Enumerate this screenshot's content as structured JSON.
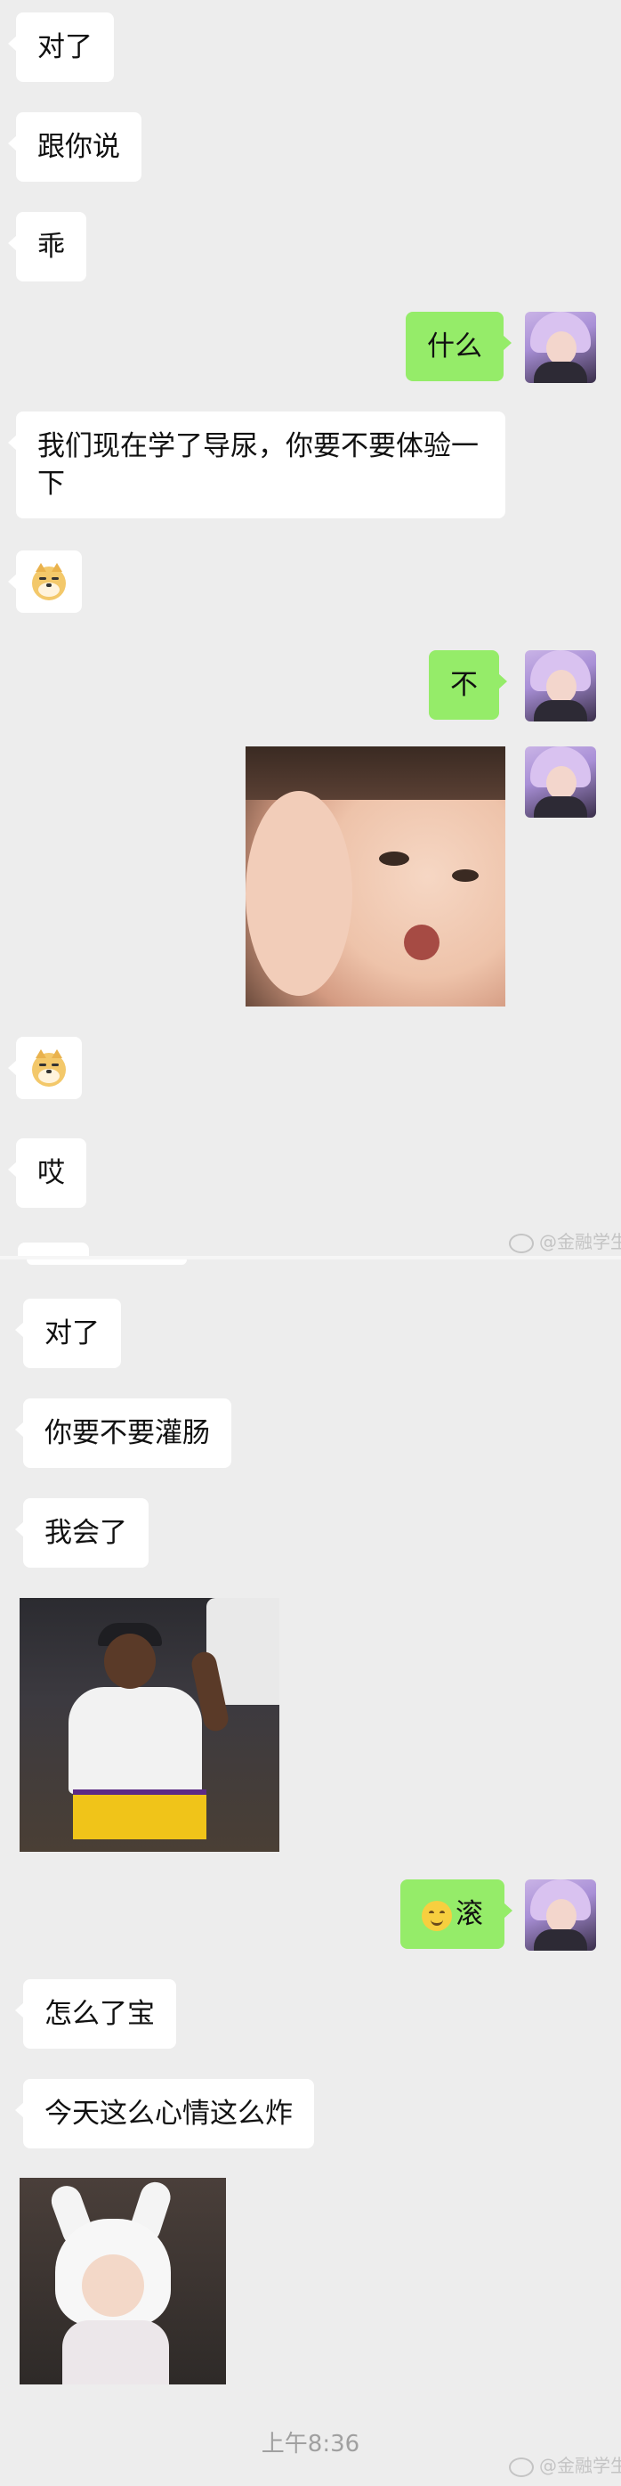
{
  "messages_top": [
    {
      "text": "对了"
    },
    {
      "text": "跟你说"
    },
    {
      "text": "乖"
    },
    {
      "text": "什么"
    },
    {
      "text": "我们现在学了导尿，你要不要体验一下"
    },
    {
      "icon": "doge-emoji"
    },
    {
      "text": "不"
    },
    {
      "icon": "doge-emoji"
    },
    {
      "text": "哎"
    }
  ],
  "messages_bottom": [
    {
      "text": "对了"
    },
    {
      "text": "你要不要灌肠"
    },
    {
      "text": "我会了"
    },
    {
      "text": "滚",
      "icon": "smile-emoji"
    },
    {
      "text": "怎么了宝"
    },
    {
      "text": "今天这么心情这么炸"
    }
  ],
  "timestamp": "上午8:36",
  "watermark": "@金融学生",
  "colors": {
    "incoming": "#ffffff",
    "outgoing": "#95ec69",
    "background": "#ededed"
  }
}
